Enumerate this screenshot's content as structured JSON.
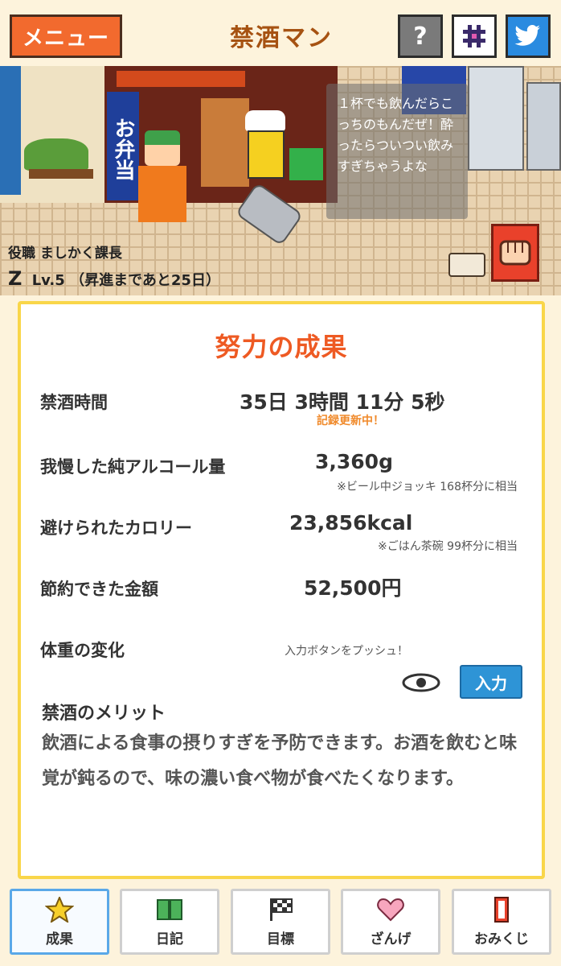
{
  "header": {
    "menu_label": "メニュー",
    "title": "禁酒マン",
    "help_label": "?"
  },
  "scene": {
    "banner_text": "お弁当",
    "speech": "１杯でも飲んだらこっちのもんだぜ！酔ったらついつい飲みすぎちゃうよな",
    "role_text": "役職 ましかく課長",
    "rank_letter": "Z",
    "rank_level": "Lv.5",
    "rank_remaining": "（昇進まであと25日）"
  },
  "results": {
    "title": "努力の成果",
    "abstinence_time": {
      "label": "禁酒時間",
      "value": "35日 3時間 11分 5秒",
      "record": "記録更新中！"
    },
    "alcohol": {
      "label": "我慢した純アルコール量",
      "value": "3,360g",
      "note": "※ビール中ジョッキ 168杯分に相当"
    },
    "calories": {
      "label": "避けられたカロリー",
      "value": "23,856kcal",
      "note": "※ごはん茶碗 99杯分に相当"
    },
    "money": {
      "label": "節約できた金額",
      "value": "52,500円"
    },
    "weight": {
      "label": "体重の変化",
      "push_text": "入力ボタンをプッシュ！",
      "input_label": "入力"
    },
    "merit": {
      "title": "禁酒のメリット",
      "text": "飲酒による食事の摂りすぎを予防できます。お酒を飲むと味覚が鈍るので、味の濃い食べ物が食べたくなります。"
    }
  },
  "tabs": [
    {
      "label": "成果",
      "icon": "star-icon",
      "active": true
    },
    {
      "label": "日記",
      "icon": "book-icon",
      "active": false
    },
    {
      "label": "目標",
      "icon": "checkered-flag-icon",
      "active": false
    },
    {
      "label": "ざんげ",
      "icon": "heart-icon",
      "active": false
    },
    {
      "label": "おみくじ",
      "icon": "omikuji-icon",
      "active": false
    }
  ],
  "colors": {
    "background": "#fdf3dc",
    "menu": "#f26a2e",
    "title": "#a65212",
    "accent_orange": "#ee5a23",
    "panel_border": "#f9d649",
    "input_button": "#2e94d6",
    "twitter": "#2a8be0",
    "fist_button": "#e9412b"
  }
}
